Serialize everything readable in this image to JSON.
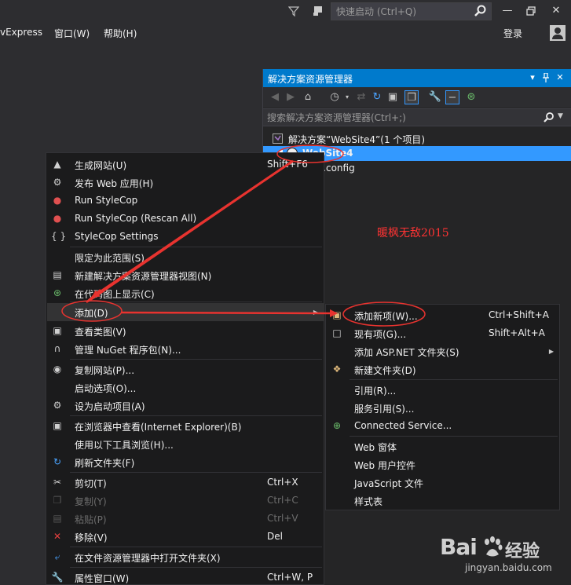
{
  "titlebar": {
    "quick_launch_placeholder": "快速启动 (Ctrl+Q)",
    "icons": [
      "filter-icon",
      "notification-icon",
      "search-icon",
      "minimize-icon",
      "restore-icon",
      "close-icon"
    ]
  },
  "menubar": {
    "items": [
      "vExpress",
      "窗口(W)",
      "帮助(H)"
    ],
    "sign_in": "登录"
  },
  "solution_explorer": {
    "title": "解决方案资源管理器",
    "search_placeholder": "搜索解决方案资源管理器(Ctrl+;)",
    "tree": [
      {
        "label": "解决方案“WebSite4”(1 个项目)"
      },
      {
        "label": "WebSite4",
        "selected": true
      },
      {
        "label": "Web.config"
      }
    ]
  },
  "annotation_text": "暖枫无敌2015",
  "context_menu": {
    "items": [
      {
        "label": "生成网站(U)",
        "shortcut": "Shift+F6",
        "icon": "build-icon"
      },
      {
        "label": "发布 Web 应用(H)",
        "shortcut": "",
        "icon": "publish-icon"
      },
      {
        "label": "Run StyleCop",
        "shortcut": "",
        "icon": "stylecop-icon"
      },
      {
        "label": "Run StyleCop (Rescan All)",
        "shortcut": "",
        "icon": "stylecop-rescan-icon"
      },
      {
        "label": "StyleCop Settings",
        "shortcut": "",
        "icon": "braces-icon"
      },
      {
        "label": "限定为此范围(S)",
        "shortcut": "",
        "icon": ""
      },
      {
        "label": "新建解决方案资源管理器视图(N)",
        "shortcut": "",
        "icon": "new-view-icon"
      },
      {
        "label": "在代码图上显示(C)",
        "shortcut": "",
        "icon": "code-map-icon"
      },
      {
        "label": "添加(D)",
        "shortcut": "",
        "icon": "",
        "submenu": true,
        "highlighted": true
      },
      {
        "label": "查看类图(V)",
        "shortcut": "",
        "icon": "class-diagram-icon"
      },
      {
        "label": "管理 NuGet 程序包(N)...",
        "shortcut": "",
        "icon": "nuget-icon"
      },
      {
        "label": "复制网站(P)...",
        "shortcut": "",
        "icon": "copy-website-icon"
      },
      {
        "label": "启动选项(O)...",
        "shortcut": "",
        "icon": ""
      },
      {
        "label": "设为启动项目(A)",
        "shortcut": "",
        "icon": "gear-icon"
      },
      {
        "label": "在浏览器中查看(Internet Explorer)(B)",
        "shortcut": "",
        "icon": "browser-icon"
      },
      {
        "label": "使用以下工具浏览(H)...",
        "shortcut": "",
        "icon": ""
      },
      {
        "label": "刷新文件夹(F)",
        "shortcut": "",
        "icon": "refresh-icon"
      },
      {
        "label": "剪切(T)",
        "shortcut": "Ctrl+X",
        "icon": "cut-icon"
      },
      {
        "label": "复制(Y)",
        "shortcut": "Ctrl+C",
        "icon": "copy-icon",
        "disabled": true
      },
      {
        "label": "粘贴(P)",
        "shortcut": "Ctrl+V",
        "icon": "paste-icon",
        "disabled": true
      },
      {
        "label": "移除(V)",
        "shortcut": "Del",
        "icon": "remove-icon"
      },
      {
        "label": "在文件资源管理器中打开文件夹(X)",
        "shortcut": "",
        "icon": "open-folder-icon"
      },
      {
        "label": "属性窗口(W)",
        "shortcut": "Ctrl+W, P",
        "icon": "wrench-icon"
      }
    ]
  },
  "add_submenu": {
    "items": [
      {
        "label": "添加新项(W)...",
        "shortcut": "Ctrl+Shift+A",
        "icon": "new-item-icon"
      },
      {
        "label": "现有项(G)...",
        "shortcut": "Shift+Alt+A",
        "icon": "existing-item-icon"
      },
      {
        "label": "添加 ASP.NET 文件夹(S)",
        "shortcut": "",
        "icon": "",
        "submenu": true
      },
      {
        "label": "新建文件夹(D)",
        "shortcut": "",
        "icon": "new-folder-icon"
      },
      {
        "label": "引用(R)...",
        "shortcut": "",
        "icon": ""
      },
      {
        "label": "服务引用(S)...",
        "shortcut": "",
        "icon": ""
      },
      {
        "label": "Connected Service...",
        "shortcut": "",
        "icon": "connected-service-icon"
      },
      {
        "label": "Web 窗体",
        "shortcut": "",
        "icon": ""
      },
      {
        "label": "Web 用户控件",
        "shortcut": "",
        "icon": ""
      },
      {
        "label": "JavaScript 文件",
        "shortcut": "",
        "icon": ""
      },
      {
        "label": "样式表",
        "shortcut": "",
        "icon": ""
      }
    ]
  },
  "watermark": {
    "logo": "Bai",
    "logo_suffix": "经验",
    "url": "jingyan.baidu.com"
  },
  "colors": {
    "accent": "#007acc",
    "selection": "#3399ff",
    "annotation_red": "#e8332f",
    "menu_bg": "#1b1b1c"
  }
}
